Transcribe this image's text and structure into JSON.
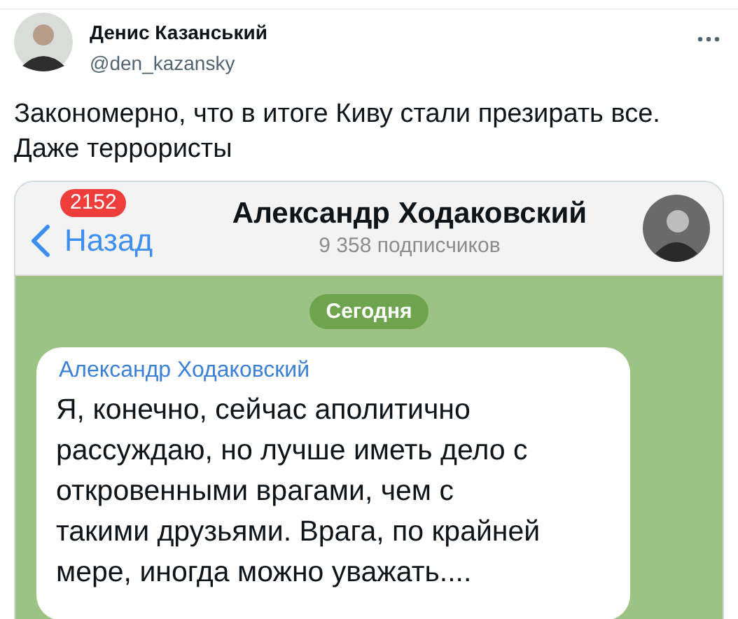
{
  "tweet": {
    "author_name": "Денис Казанський",
    "author_handle": "@den_kazansky",
    "text": "Закономерно, что в итоге Киву стали презирать все. Даже террористы"
  },
  "embedded_screenshot": {
    "header": {
      "back_label": "Назад",
      "unread_badge": "2152",
      "channel_title": "Александр Ходаковский",
      "subscribers": "9 358 подписчиков"
    },
    "date_chip": "Сегодня",
    "message": {
      "sender": "Александр Ходаковский",
      "text": "Я, конечно, сейчас аполитично рассуждаю, но лучше иметь дело с откровенными врагами, чем с такими друзьями. Врага, по крайней мере, иногда можно уважать...."
    }
  }
}
